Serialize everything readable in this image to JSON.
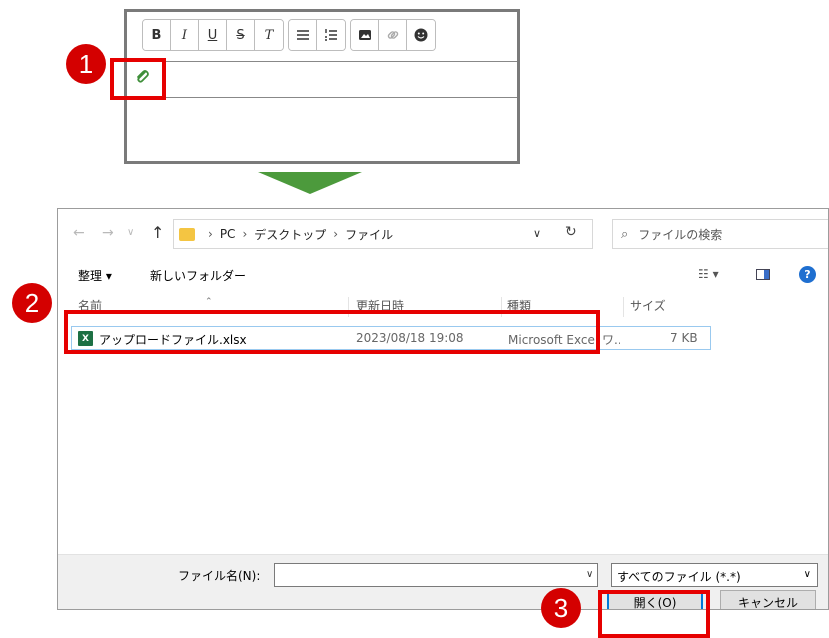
{
  "editor": {
    "toolbar": {
      "bold": "B",
      "italic": "I",
      "underline": "U",
      "strike": "S",
      "clear_format": "T",
      "icons": [
        "bold-icon",
        "italic-icon",
        "underline-icon",
        "strikethrough-icon",
        "clear-format-icon",
        "bullet-list-icon",
        "numbered-list-icon",
        "image-icon",
        "link-icon",
        "emoji-icon"
      ]
    },
    "attach_icon": "paperclip-icon"
  },
  "steps": [
    "1",
    "2",
    "3"
  ],
  "colors": {
    "highlight": "#e60000",
    "badge": "#d40000",
    "arrow": "#4c9a3c",
    "accent": "#0078d7"
  },
  "dialog": {
    "path": [
      "PC",
      "デスクトップ",
      "ファイル"
    ],
    "search_placeholder": "ファイルの検索",
    "organize_label": "整理 ▾",
    "new_folder_label": "新しいフォルダー",
    "columns": {
      "name": "名前",
      "modified": "更新日時",
      "type": "種類",
      "size": "サイズ"
    },
    "files": [
      {
        "name": "アップロードファイル.xlsx",
        "modified": "2023/08/18 19:08",
        "type": "Microsoft Excel ワ...",
        "size": "7 KB",
        "icon": "excel-file-icon"
      }
    ],
    "file_name_label": "ファイル名(N):",
    "file_name_value": "",
    "filter_value": "すべてのファイル (*.*)",
    "open_button": "開く(O)",
    "cancel_button": "キャンセル"
  }
}
